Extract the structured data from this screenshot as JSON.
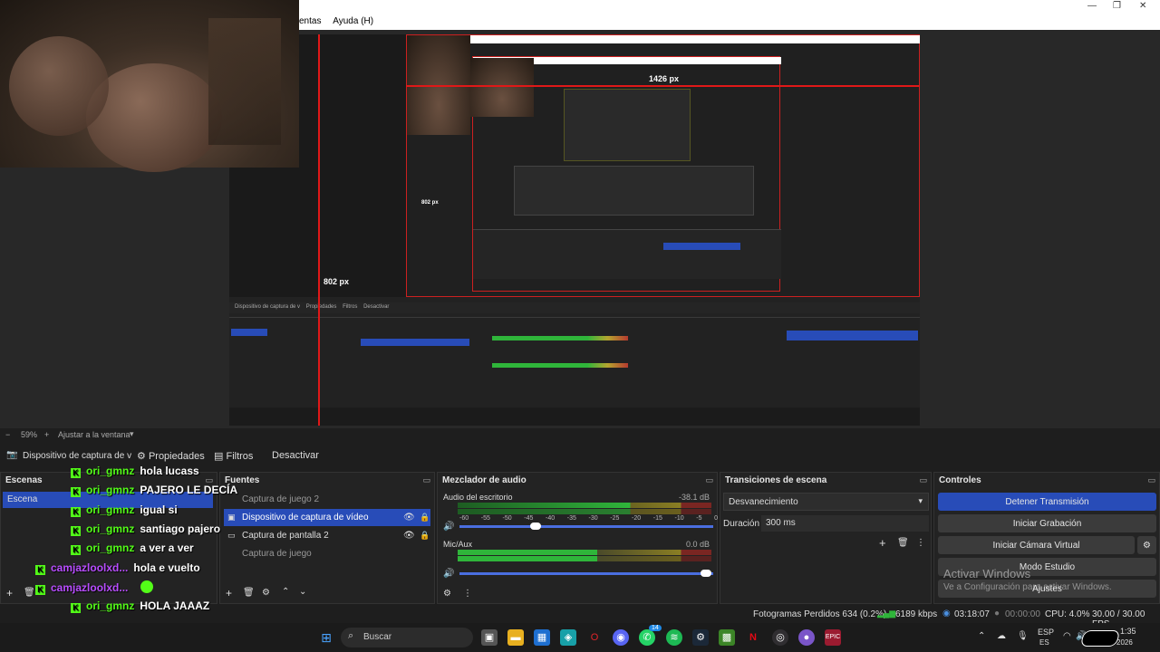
{
  "menu": {
    "partial_item": "entas",
    "help": "Ayuda (H)"
  },
  "preview": {
    "measure_h": "1426 px",
    "measure_v": "802 px",
    "measure_v2": "802 px"
  },
  "zoom": {
    "minus": "−",
    "level": "59%",
    "plus": "+",
    "fit": "Ajustar a la ventana"
  },
  "source_toolbar": {
    "source_name": "Dispositivo de captura de v",
    "properties": "Propiedades",
    "filters": "Filtros",
    "deactivate": "Desactivar"
  },
  "scenes": {
    "title": "Escenas",
    "items": [
      "Escena"
    ]
  },
  "sources": {
    "title": "Fuentes",
    "items": [
      "Captura de juego 2",
      "Dispositivo de captura de vídeo",
      "Captura de pantalla 2",
      "Captura de juego"
    ]
  },
  "mixer": {
    "title": "Mezclador de audio",
    "channels": [
      {
        "name": "Audio del escritorio",
        "db": "-38.1 dB"
      },
      {
        "name": "Mic/Aux",
        "db": "0.0 dB"
      }
    ],
    "ticks": [
      "-60",
      "-55",
      "-50",
      "-45",
      "-40",
      "-35",
      "-30",
      "-25",
      "-20",
      "-15",
      "-10",
      "-5",
      "0"
    ]
  },
  "transitions": {
    "title": "Transiciones de escena",
    "selected": "Desvanecimiento",
    "duration_label": "Duración",
    "duration_value": "300 ms"
  },
  "controls": {
    "title": "Controles",
    "stop_stream": "Detener Transmisión",
    "start_recording": "Iniciar Grabación",
    "start_vcam": "Iniciar Cámara Virtual",
    "studio_mode": "Modo Estudio",
    "settings": "Ajustes"
  },
  "watermark": {
    "line1": "Activar Windows",
    "line2": "Ve a Configuración para activar Windows."
  },
  "chat": [
    {
      "user": "ori_gmnz",
      "msg": "hola lucass",
      "color": "green"
    },
    {
      "user": "ori_gmnz",
      "msg": "PAJERO LE DECÍA",
      "color": "green"
    },
    {
      "user": "ori_gmnz",
      "msg": "igual si",
      "color": "green"
    },
    {
      "user": "ori_gmnz",
      "msg": "santiago pajero",
      "color": "green"
    },
    {
      "user": "ori_gmnz",
      "msg": "a ver a ver",
      "color": "green"
    },
    {
      "user": "camjazloolxd...",
      "msg": "hola e vuelto",
      "color": "purple"
    },
    {
      "user": "camjazloolxd...",
      "msg": "",
      "color": "purple"
    },
    {
      "user": "ori_gmnz",
      "msg": "HOLA JAAAZ",
      "color": "green"
    }
  ],
  "status": {
    "dropped": "Fotogramas Perdidos 634 (0.2%)",
    "bitrate": "6189 kbps",
    "live_time": "03:18:07",
    "rec_time": "00:00:00",
    "cpu": "CPU: 4.0%",
    "fps": "30.00 / 30.00 FPS"
  },
  "taskbar": {
    "search_placeholder": "Buscar",
    "lang": "ESP",
    "lang2": "ES",
    "time": "1:35",
    "date": "2026",
    "badge": "14"
  },
  "colors": {
    "accent": "#284cb8",
    "kick_green": "#53fc18",
    "purple": "#b84dff",
    "meter_green": "#2fb53a",
    "meter_yellow": "#b5a52f",
    "meter_red": "#b53a2f"
  }
}
